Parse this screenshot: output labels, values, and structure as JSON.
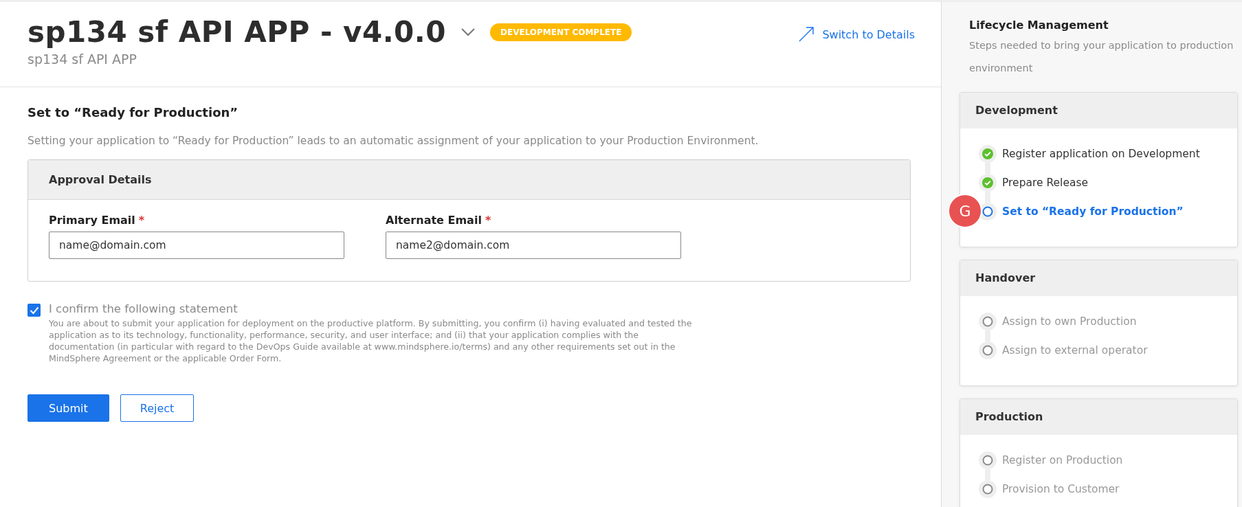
{
  "header": {
    "title": "sp134 sf API APP - v4.0.0",
    "subtitle": "sp134 sf API APP",
    "badge": "DEVELOPMENT COMPLETE",
    "link": "Switch to Details"
  },
  "section": {
    "title": "Set to “Ready for Production”",
    "description": "Setting your application to “Ready for Production” leads to an automatic assignment of your application to your Production Environment."
  },
  "approval": {
    "title": "Approval Details",
    "fields": [
      {
        "label": "Primary Email",
        "required_mark": "*",
        "value": "name@domain.com"
      },
      {
        "label": "Alternate Email",
        "required_mark": "*",
        "value": "name2@domain.com"
      }
    ]
  },
  "confirm": {
    "checked": true,
    "label": "I confirm the following statement",
    "text": "You are about to submit your application for deployment on the productive platform. By submitting, you confirm (i) having evaluated and tested the application as to its technology, functionality, performance, security, and user interface; and (ii) that your application complies with the documentation (in particular with regard to the DevOps Guide available at www.mindsphere.io/terms) and any other requirements set out in the MindSphere Agreement or the applicable Order Form."
  },
  "buttons": [
    {
      "label": "Submit",
      "kind": "primary"
    },
    {
      "label": "Reject",
      "kind": "secondary"
    }
  ],
  "sidebar": {
    "title": "Lifecycle Management",
    "description": "Steps needed to bring your application to production environment",
    "avatar": "G",
    "stages": [
      {
        "title": "Development",
        "steps": [
          {
            "label": "Register application on Development",
            "completed": true,
            "active": false
          },
          {
            "label": "Prepare Release",
            "completed": true,
            "active": false
          },
          {
            "label": "Set to “Ready for Production”",
            "completed": false,
            "active": true
          }
        ]
      },
      {
        "title": "Handover",
        "steps": [
          {
            "label": "Assign to own Production",
            "completed": false,
            "active": false
          },
          {
            "label": "Assign to external operator",
            "completed": false,
            "active": false
          }
        ]
      },
      {
        "title": "Production",
        "steps": [
          {
            "label": "Register on Production",
            "completed": false,
            "active": false
          },
          {
            "label": "Provision to Customer",
            "completed": false,
            "active": false
          }
        ]
      }
    ]
  }
}
